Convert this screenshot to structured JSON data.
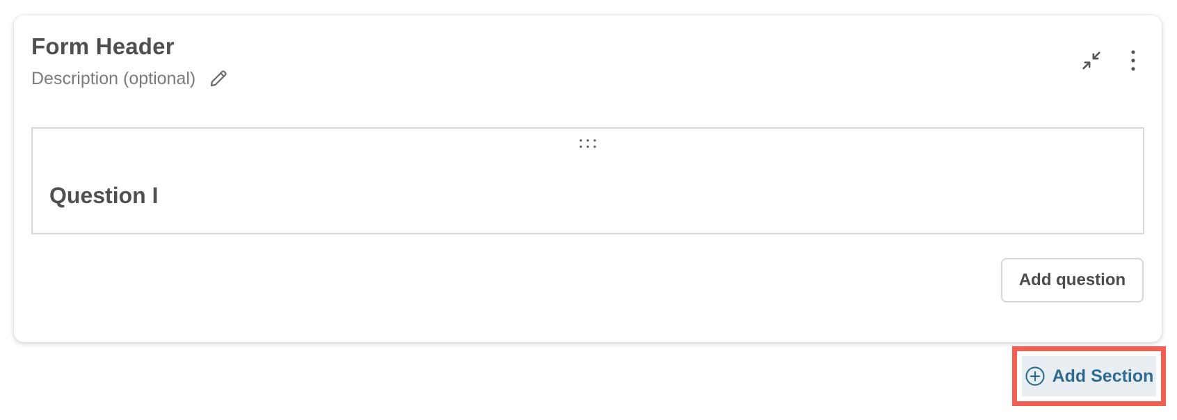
{
  "form": {
    "title": "Form Header",
    "description_placeholder": "Description (optional)",
    "icons": {
      "edit": "pencil-icon",
      "collapse": "collapse-arrows-icon",
      "more": "vertical-ellipsis-icon"
    }
  },
  "question": {
    "title": "Question I",
    "drag_icon": "drag-dots-icon"
  },
  "actions": {
    "add_question_label": "Add question",
    "add_section_label": "Add Section",
    "add_section_icon": "plus-circle-icon"
  },
  "colors": {
    "accent": "#2f6b90",
    "highlight": "#f25f52",
    "add_section_bg": "#e9eef2"
  }
}
